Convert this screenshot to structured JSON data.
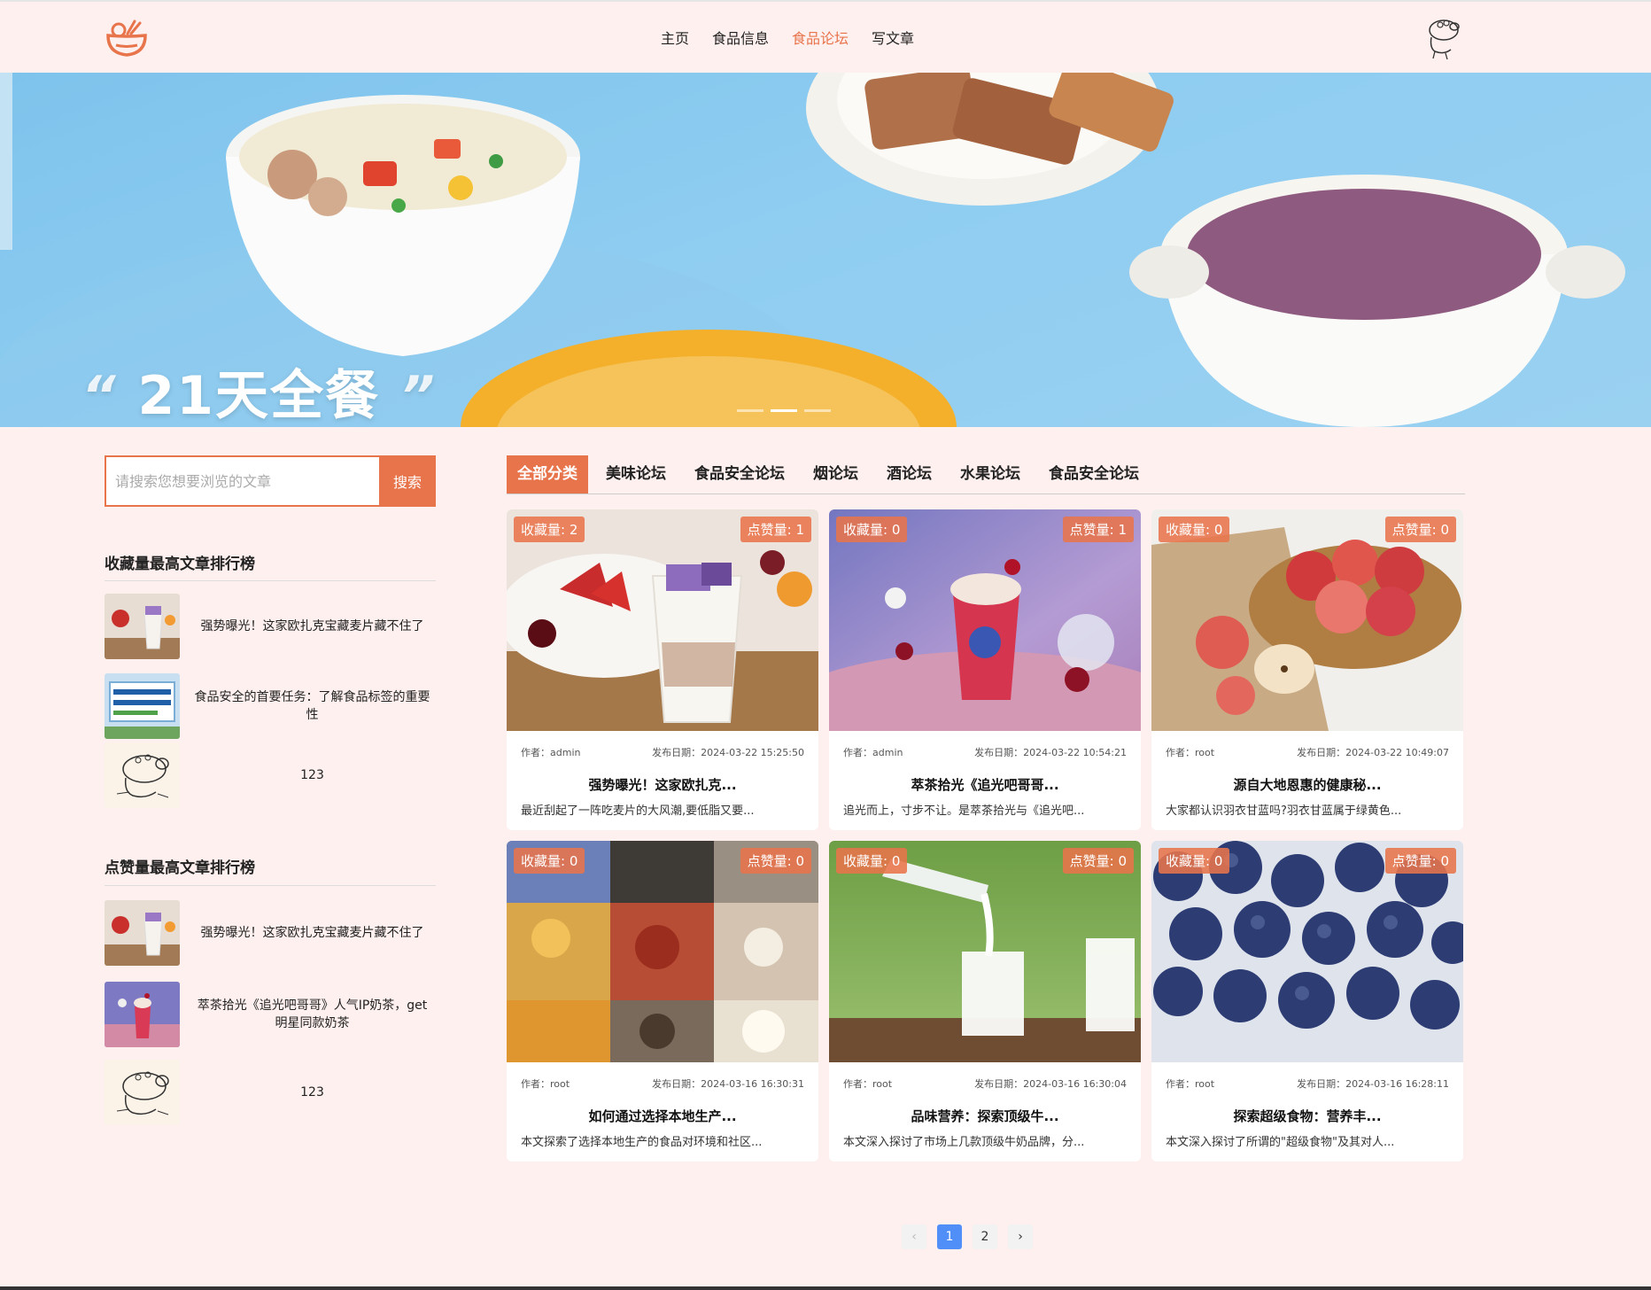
{
  "nav": {
    "items": [
      "主页",
      "食品信息",
      "食品论坛",
      "写文章"
    ],
    "active_index": 2
  },
  "colors": {
    "accent": "#e8744b",
    "page_bg": "#fdf0ef",
    "pager_active": "#4f8ff7"
  },
  "banner": {
    "title": "21天全餐",
    "dots": 3,
    "active_dot": 1
  },
  "search": {
    "placeholder": "请搜索您想要浏览的文章",
    "button_label": "搜索"
  },
  "rank_favorites": {
    "title": "收藏量最高文章排行榜",
    "items": [
      {
        "text": "强势曝光！这家欧扎克宝藏麦片藏不住了",
        "thumb": "parfait"
      },
      {
        "text": "食品安全的首要任务：了解食品标签的重要性",
        "thumb": "sign"
      },
      {
        "text": "123",
        "thumb": "pig"
      }
    ]
  },
  "rank_likes": {
    "title": "点赞量最高文章排行榜",
    "items": [
      {
        "text": "强势曝光！这家欧扎克宝藏麦片藏不住了",
        "thumb": "parfait"
      },
      {
        "text": "萃茶拾光《追光吧哥哥》人气IP奶茶，get明星同款奶茶",
        "thumb": "bubbletea"
      },
      {
        "text": "123",
        "thumb": "pig"
      }
    ]
  },
  "tabs": [
    "全部分类",
    "美味论坛",
    "食品安全论坛",
    "烟论坛",
    "酒论坛",
    "水果论坛",
    "食品安全论坛"
  ],
  "tabs_active": 0,
  "cards": [
    {
      "fav": "收藏量: 2",
      "like": "点赞量: 1",
      "author": "作者：admin",
      "date": "发布日期：2024-03-22 15:25:50",
      "title": "强势曝光！这家欧扎克...",
      "desc": "最近刮起了一阵吃麦片的大风潮,要低脂又要...",
      "image": "parfait"
    },
    {
      "fav": "收藏量: 0",
      "like": "点赞量: 1",
      "author": "作者：admin",
      "date": "发布日期：2024-03-22 10:54:21",
      "title": "萃茶拾光《追光吧哥哥...",
      "desc": "追光而上，寸步不让。是萃茶拾光与《追光吧...",
      "image": "bubbletea"
    },
    {
      "fav": "收藏量: 0",
      "like": "点赞量: 0",
      "author": "作者：root",
      "date": "发布日期：2024-03-22 10:49:07",
      "title": "源自大地恩惠的健康秘...",
      "desc": "大家都认识羽衣甘蓝吗?羽衣甘蓝属于绿黄色...",
      "image": "apples"
    },
    {
      "fav": "收藏量: 0",
      "like": "点赞量: 0",
      "author": "作者：root",
      "date": "发布日期：2024-03-16 16:30:31",
      "title": "如何通过选择本地生产...",
      "desc": "本文探索了选择本地生产的食品对环境和社区...",
      "image": "collage"
    },
    {
      "fav": "收藏量: 0",
      "like": "点赞量: 0",
      "author": "作者：root",
      "date": "发布日期：2024-03-16 16:30:04",
      "title": "品味营养：探索顶级牛...",
      "desc": "本文深入探讨了市场上几款顶级牛奶品牌，分...",
      "image": "milk"
    },
    {
      "fav": "收藏量: 0",
      "like": "点赞量: 0",
      "author": "作者：root",
      "date": "发布日期：2024-03-16 16:28:11",
      "title": "探索超级食物：营养丰...",
      "desc": "本文深入探讨了所谓的\"超级食物\"及其对人...",
      "image": "blueberries"
    }
  ],
  "pagination": {
    "prev": "‹",
    "pages": [
      "1",
      "2"
    ],
    "current": "1",
    "next": "›"
  }
}
